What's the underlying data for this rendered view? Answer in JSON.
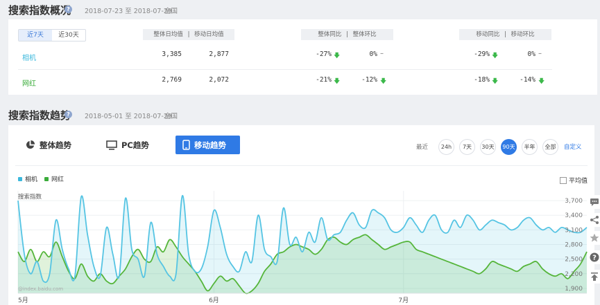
{
  "overview": {
    "title": "搜索指数概况",
    "date_range": "2018-07-23 至 2018-07-29",
    "region": "全国",
    "toggle": [
      "近7天",
      "近30天"
    ],
    "headers": {
      "avg": [
        "整体日均值",
        "|",
        "移动日均值"
      ],
      "overall": [
        "整体同比",
        "|",
        "整体环比"
      ],
      "mobile": [
        "移动同比",
        "|",
        "移动环比"
      ]
    },
    "rows": [
      {
        "keyword": "相机",
        "color": "#3bb8dc",
        "overall_avg": "3,385",
        "mobile_avg": "2,877",
        "overall_yoy": "-27%",
        "overall_mom": "0%",
        "mobile_yoy": "-29%",
        "mobile_mom": "0%"
      },
      {
        "keyword": "网红",
        "color": "#3aac3a",
        "overall_avg": "2,769",
        "mobile_avg": "2,072",
        "overall_yoy": "-21%",
        "overall_mom": "-12%",
        "mobile_yoy": "-18%",
        "mobile_mom": "-14%"
      }
    ]
  },
  "trend": {
    "title": "搜索指数趋势",
    "date_range": "2018-05-01 至 2018-07-29",
    "region": "全国",
    "tabs": [
      "整体趋势",
      "PC趋势",
      "移动趋势"
    ],
    "range_label": "最近",
    "ranges": [
      "24h",
      "7天",
      "30天",
      "90天",
      "半年",
      "全部"
    ],
    "custom": "自定义",
    "avg_label": "平均值",
    "watermark": "@index.baidu.com"
  },
  "chart_data": {
    "type": "area",
    "ylabel": "搜索指数",
    "yticks": [
      "3,700",
      "3,400",
      "3,100",
      "2,800",
      "2,500",
      "2,200",
      "1,900"
    ],
    "ylim": [
      1800,
      3900
    ],
    "xticks": [
      {
        "label": "5月",
        "index": 0
      },
      {
        "label": "6月",
        "index": 31
      },
      {
        "label": "7月",
        "index": 61
      }
    ],
    "legend_placement": "top-left",
    "series": [
      {
        "name": "相机",
        "color": "#55c4e3",
        "values": [
          3700,
          2600,
          2200,
          2450,
          2050,
          2200,
          3300,
          2700,
          2300,
          2150,
          3780,
          3000,
          2350,
          2150,
          3150,
          2600,
          2150,
          3750,
          2700,
          2500,
          2150,
          3250,
          2600,
          2350,
          2150,
          2200,
          3800,
          2600,
          2250,
          2300,
          2750,
          3500,
          3150,
          2600,
          2350,
          2250,
          2650,
          2450,
          3400,
          2700,
          2550,
          2450,
          3550,
          2800,
          2950,
          2650,
          3050,
          2850,
          3350,
          2900,
          3000,
          3050,
          3300,
          3450,
          3200,
          3150,
          3500,
          3450,
          3350,
          3100,
          3050,
          3150,
          3350,
          3200,
          3050,
          3300,
          3400,
          3100,
          3050,
          3300,
          3150,
          3400,
          3300,
          3100,
          3200,
          3300,
          3250,
          3200,
          3100,
          3150,
          3300,
          3350,
          3200,
          3100,
          3150,
          3050,
          3150,
          3100,
          3050,
          3050,
          3150
        ]
      },
      {
        "name": "网红",
        "color": "#55b53a",
        "values": [
          2650,
          2450,
          2700,
          2450,
          2650,
          2550,
          2850,
          2550,
          2250,
          2100,
          2400,
          2150,
          2050,
          2200,
          2050,
          2000,
          2150,
          2300,
          2550,
          2700,
          2500,
          2450,
          2750,
          2650,
          2900,
          2750,
          2550,
          2400,
          2250,
          2050,
          1850,
          2000,
          2150,
          2050,
          2100,
          1950,
          1800,
          1850,
          2000,
          2250,
          2400,
          2600,
          2650,
          2750,
          2800,
          2750,
          2700,
          2600,
          2700,
          2900,
          2950,
          2850,
          2800,
          2900,
          2950,
          3000,
          2900,
          2800,
          2700,
          2750,
          2800,
          2850,
          2850,
          2700,
          2650,
          2600,
          2550,
          2500,
          2450,
          2400,
          2350,
          2300,
          2250,
          2200,
          2300,
          2450,
          2400,
          2350,
          2300,
          2250,
          2350,
          2400,
          2450,
          2300,
          2200,
          2150,
          2200,
          2100,
          2250,
          2400,
          2650
        ]
      }
    ]
  }
}
